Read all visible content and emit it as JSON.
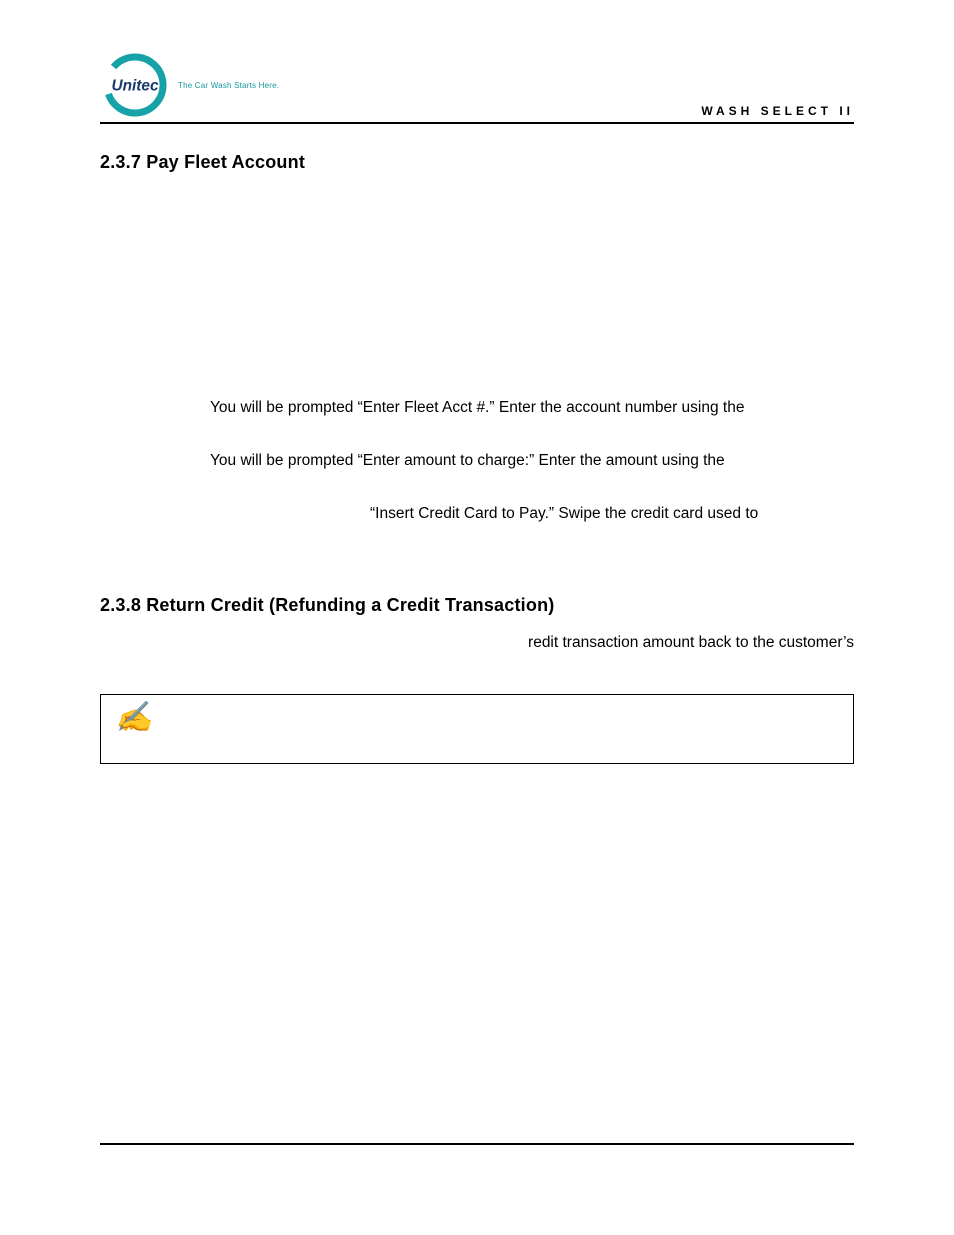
{
  "header": {
    "logo_text": "Unitec",
    "tagline": "The Car Wash Starts Here.",
    "product": "WASH SELECT II"
  },
  "sections": {
    "s237": {
      "heading": "2.3.7 Pay Fleet Account",
      "p1": "You will be prompted “Enter Fleet Acct #.” Enter the account number using the",
      "p2": "You will be prompted “Enter amount to charge:” Enter the amount using the",
      "p3": "“Insert Credit Card to Pay.” Swipe the credit card used to"
    },
    "s238": {
      "heading": "2.3.8 Return Credit (Refunding a Credit Transaction)",
      "frag": "redit transaction amount back to the customer’s"
    }
  },
  "icons": {
    "note": "✍"
  },
  "colors": {
    "brand_teal": "#17a2a8",
    "brand_navy": "#1a3a6b"
  }
}
